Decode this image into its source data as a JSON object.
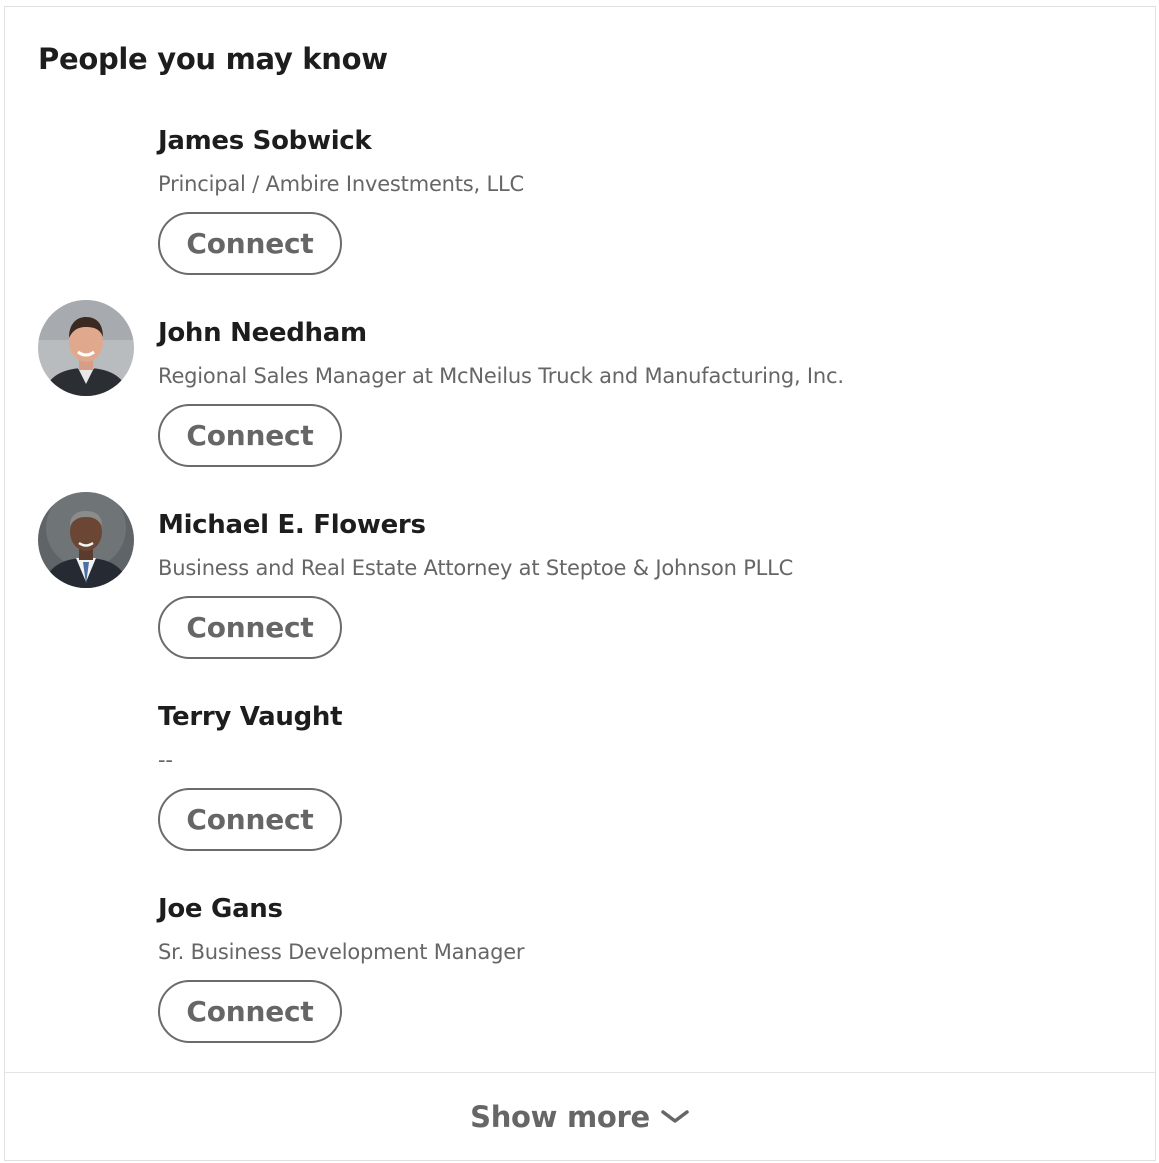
{
  "card": {
    "title": "People you may know"
  },
  "people": [
    {
      "name": "James Sobwick",
      "headline": "Principal / Ambire Investments, LLC",
      "connect_label": "Connect",
      "avatar": "none"
    },
    {
      "name": "John Needham",
      "headline": "Regional Sales Manager at McNeilus Truck and Manufacturing, Inc.",
      "connect_label": "Connect",
      "avatar": "photo"
    },
    {
      "name": "Michael E. Flowers",
      "headline": "Business and Real Estate Attorney at Steptoe & Johnson PLLC",
      "connect_label": "Connect",
      "avatar": "photo"
    },
    {
      "name": "Terry Vaught",
      "headline": "--",
      "connect_label": "Connect",
      "avatar": "none"
    },
    {
      "name": "Joe Gans",
      "headline": "Sr. Business Development Manager",
      "connect_label": "Connect",
      "avatar": "none"
    }
  ],
  "footer": {
    "show_more_label": "Show more",
    "show_more_icon": "chevron-down-icon"
  },
  "colors": {
    "text_primary": "#1d1d1d",
    "text_secondary": "#666666",
    "button_border": "#6b6b6b",
    "card_border": "#e0e0e0"
  }
}
